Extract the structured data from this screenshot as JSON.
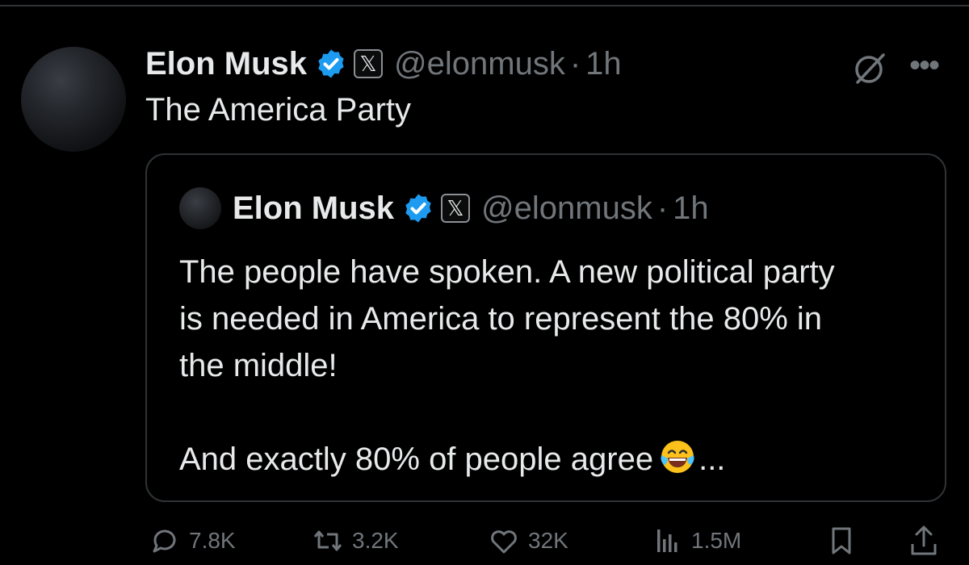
{
  "tweet": {
    "author_name": "Elon Musk",
    "handle": "@elonmusk",
    "dot": "·",
    "time": "1h",
    "text": "The America Party",
    "x_badge": "𝕏"
  },
  "quoted": {
    "author_name": "Elon Musk",
    "handle": "@elonmusk",
    "dot": "·",
    "time": "1h",
    "lines": [
      "The people have spoken. A new political party",
      "is needed in America to represent the 80% in",
      "the middle!"
    ],
    "last_line_before_emoji": "And exactly 80% of people agree",
    "last_line_after_emoji": "...",
    "x_badge": "𝕏"
  },
  "actions": {
    "replies": "7.8K",
    "reposts": "3.2K",
    "likes": "32K",
    "views": "1.5M"
  },
  "icons": {
    "verified": "verified-badge-icon",
    "x_affiliate": "x-badge-icon",
    "grok": "grok-icon",
    "more": "more-icon",
    "reply": "reply-icon",
    "repost": "repost-icon",
    "like": "like-icon",
    "views": "views-icon",
    "bookmark": "bookmark-icon",
    "share": "share-icon",
    "emoji": "laughing-tears-emoji-icon"
  },
  "colors": {
    "background": "#000000",
    "text": "#e7e9ea",
    "secondary": "#71767b",
    "border": "#2f3336",
    "verified_blue": "#1d9bf0"
  }
}
